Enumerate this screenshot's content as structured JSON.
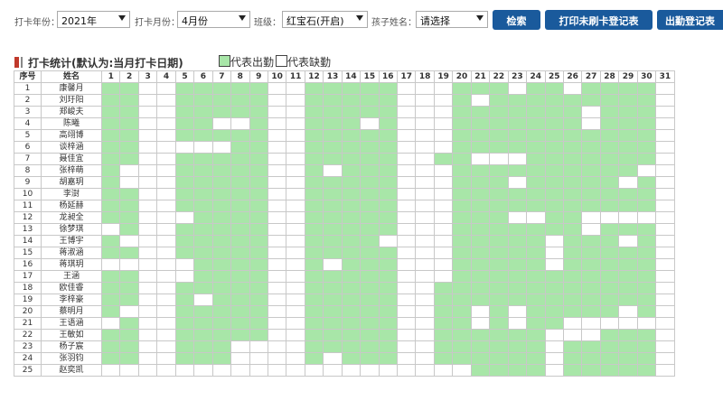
{
  "filters": {
    "year": {
      "label": "打卡年份：",
      "value": "2021年"
    },
    "month": {
      "label": "打卡月份：",
      "value": "4月份"
    },
    "class": {
      "label": "班级：",
      "value": "红宝石(开启)"
    },
    "child": {
      "label": "孩子姓名：",
      "value": "请选择"
    }
  },
  "buttons": {
    "search": "检索",
    "print": "打印未刷卡登记表",
    "attendance": "出勤登记表"
  },
  "section": {
    "title": "打卡统计(默认为:当月打卡日期)"
  },
  "legend": {
    "present": "代表出勤",
    "absent": "代表缺勤",
    "present_color": "#a8e6a8",
    "absent_color": "#ffffff"
  },
  "table": {
    "col_no": "序号",
    "col_name": "姓名",
    "days": [
      "1",
      "2",
      "3",
      "4",
      "5",
      "6",
      "7",
      "8",
      "9",
      "10",
      "11",
      "12",
      "13",
      "14",
      "15",
      "16",
      "17",
      "18",
      "19",
      "20",
      "21",
      "22",
      "23",
      "24",
      "25",
      "26",
      "27",
      "28",
      "29",
      "30",
      "31"
    ],
    "rows": [
      {
        "no": "1",
        "name": "康馨月",
        "present": "1100111110011111000111011011110"
      },
      {
        "no": "2",
        "name": "刘玗阳",
        "present": "1100111110011111000101111111110"
      },
      {
        "no": "3",
        "name": "郑峻夫",
        "present": "1100111110011111000111111101110"
      },
      {
        "no": "4",
        "name": "陈曦",
        "present": "1100110010011101000111111101110"
      },
      {
        "no": "5",
        "name": "高翊博",
        "present": "1100111110011111000111111111110"
      },
      {
        "no": "6",
        "name": "谈梓涵",
        "present": "1100000110011111000111111111110"
      },
      {
        "no": "7",
        "name": "聂佳宜",
        "present": "1100111110011111001100011111110"
      },
      {
        "no": "8",
        "name": "张梓萌",
        "present": "1000111110010111000111111111100"
      },
      {
        "no": "9",
        "name": "胡嘉玥",
        "present": "1000111110011111000111011111010"
      },
      {
        "no": "10",
        "name": "李澍",
        "present": "1100111110011111000111111111110"
      },
      {
        "no": "11",
        "name": "杨延赫",
        "present": "1100111110011111000111111111110"
      },
      {
        "no": "12",
        "name": "龙昶全",
        "present": "1100011110011111000111001100000"
      },
      {
        "no": "13",
        "name": "徐梦琪",
        "present": "0100111110011111000111111101110"
      },
      {
        "no": "14",
        "name": "王博宇",
        "present": "1000111110011110000111110111010"
      },
      {
        "no": "15",
        "name": "蒋淑涵",
        "present": "1100111110011111000111110111110"
      },
      {
        "no": "16",
        "name": "蒋琪玥",
        "present": "0000011110010111000111110111110"
      },
      {
        "no": "17",
        "name": "王涵",
        "present": "1100011110011111000111111111110"
      },
      {
        "no": "18",
        "name": "欧佳睿",
        "present": "1100111110011111001111111111110"
      },
      {
        "no": "19",
        "name": "李梓豪",
        "present": "1100101110011111001111111111110"
      },
      {
        "no": "20",
        "name": "蔡明月",
        "present": "1000111110011111001101011111010"
      },
      {
        "no": "21",
        "name": "王语涵",
        "present": "0100111110011111001101011000000"
      },
      {
        "no": "22",
        "name": "王敏如",
        "present": "1100111110011111001111110001110"
      },
      {
        "no": "23",
        "name": "杨子宸",
        "present": "1100111000011111001111110111110"
      },
      {
        "no": "24",
        "name": "张羽钧",
        "present": "1100111000010111001111110111110"
      },
      {
        "no": "25",
        "name": "赵奕凯",
        "present": "0000000000000000000011110111110"
      }
    ]
  }
}
